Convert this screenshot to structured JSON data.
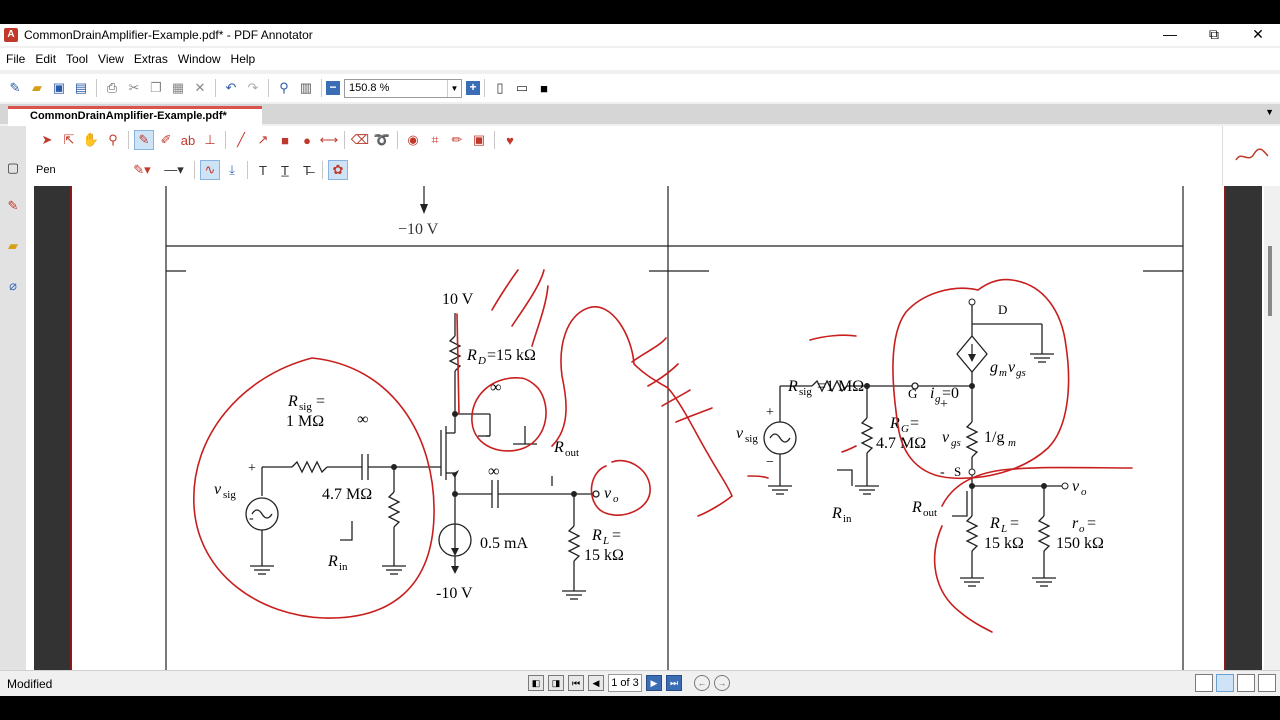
{
  "window": {
    "title": "CommonDrainAmplifier-Example.pdf* - PDF Annotator",
    "minimize": "—",
    "maximize": "⧉",
    "close": "✕"
  },
  "menu": [
    "File",
    "Edit",
    "Tool",
    "View",
    "Extras",
    "Window",
    "Help"
  ],
  "toolbar": {
    "zoom_value": "150.8 %"
  },
  "tab": {
    "label": "CommonDrainAmplifier-Example.pdf*"
  },
  "annotation_toolbar": {
    "tool_label": "Pen",
    "pen_color": "#c0392b"
  },
  "document": {
    "top_label": "−10 V",
    "left_circuit": {
      "supply_top": "10 V",
      "rd_label": "R",
      "rd_sub": "D",
      "rd_value": "=15 kΩ",
      "rsig_label": "R",
      "rsig_sub": "sig",
      "rsig_eq": "=",
      "rsig_value": "1 MΩ",
      "cap_inf_1": "∞",
      "cap_inf_2": "∞",
      "cap_inf_3": "∞",
      "rg_value": "4.7 MΩ",
      "vsig_label": "v",
      "vsig_sub": "sig",
      "plus": "+",
      "minus": "-",
      "rin_label": "R",
      "rin_sub": "in",
      "rout_label": "R",
      "rout_sub": "out",
      "isrc_value": "0.5 mA",
      "rl_label": "R",
      "rl_sub": "L",
      "rl_eq": "=",
      "rl_value": "15 kΩ",
      "vo_label": "v",
      "vo_sub": "o",
      "supply_bottom": "-10 V"
    },
    "right_circuit": {
      "rsig_label": "R",
      "rsig_sub": "sig",
      "rsig_value": "=1 MΩ",
      "node_g": "G",
      "node_d": "D",
      "node_s": "S",
      "ig_label": "i",
      "ig_sub": "g",
      "ig_value": "=0",
      "gm_label": "g",
      "gm_sub": "m",
      "vgs_in_src": "v",
      "vgs_in_src_sub": "gs",
      "rg_label": "R",
      "rg_sub": "G",
      "rg_eq": "=",
      "rg_value": "4.7 MΩ",
      "vsig_label": "v",
      "vsig_sub": "sig",
      "plus": "+",
      "minus": "−",
      "vgs_label": "v",
      "vgs_sub": "gs",
      "inv_gm": "1/g",
      "inv_gm_sub": "m",
      "rin_label": "R",
      "rin_sub": "in",
      "rout_label": "R",
      "rout_sub": "out",
      "rl_label": "R",
      "rl_sub": "L",
      "rl_eq": "=",
      "rl_value": "15 kΩ",
      "ro_label": "r",
      "ro_sub": "o",
      "ro_eq": "=",
      "ro_value": "150 kΩ",
      "vo_label": "v",
      "vo_sub": "o",
      "gate_plus": "+",
      "source_minus": "-"
    }
  },
  "status": {
    "text": "Modified",
    "page_indicator": "1 of 3"
  }
}
